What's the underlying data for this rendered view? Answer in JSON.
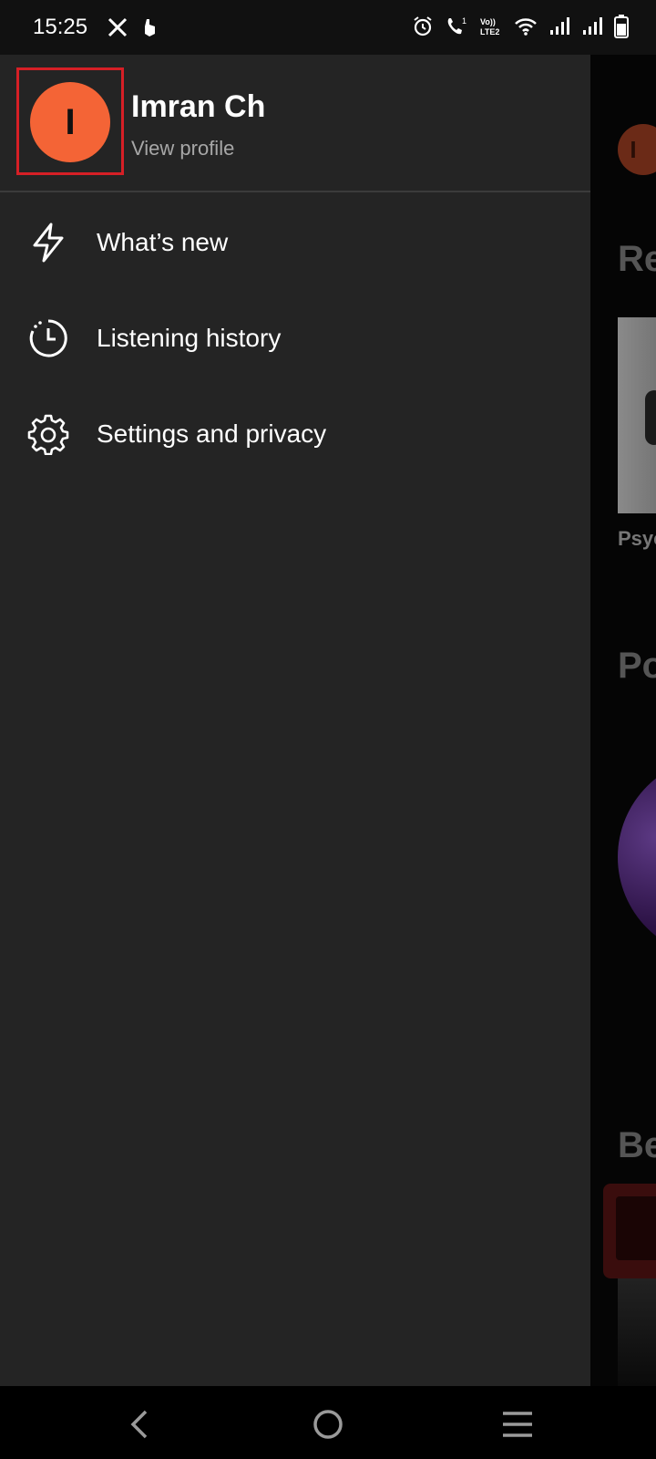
{
  "status_bar": {
    "time": "15:25",
    "left_icons": [
      "x-icon",
      "hand-icon"
    ],
    "right_icons": [
      "alarm-icon",
      "call-icon",
      "volte-icon",
      "wifi-icon",
      "signal-icon",
      "signal-icon",
      "battery-icon"
    ],
    "volte_text": "Vo)) LTE2"
  },
  "drawer": {
    "profile": {
      "avatar_letter": "I",
      "name": "Imran Ch",
      "subtitle": "View profile",
      "avatar_color": "#f46436",
      "highlight_color": "#d61f26"
    },
    "menu": [
      {
        "label": "What’s new",
        "icon": "lightning-icon"
      },
      {
        "label": "Listening history",
        "icon": "history-clock-icon"
      },
      {
        "label": "Settings and privacy",
        "icon": "gear-icon"
      }
    ]
  },
  "background": {
    "avatar_letter": "I",
    "heading_1": "Re",
    "caption_1": "Psyc",
    "heading_2": "Po",
    "heading_3": "Be"
  },
  "nav_bar": {
    "buttons": [
      "back-icon",
      "home-icon",
      "recents-icon"
    ]
  }
}
